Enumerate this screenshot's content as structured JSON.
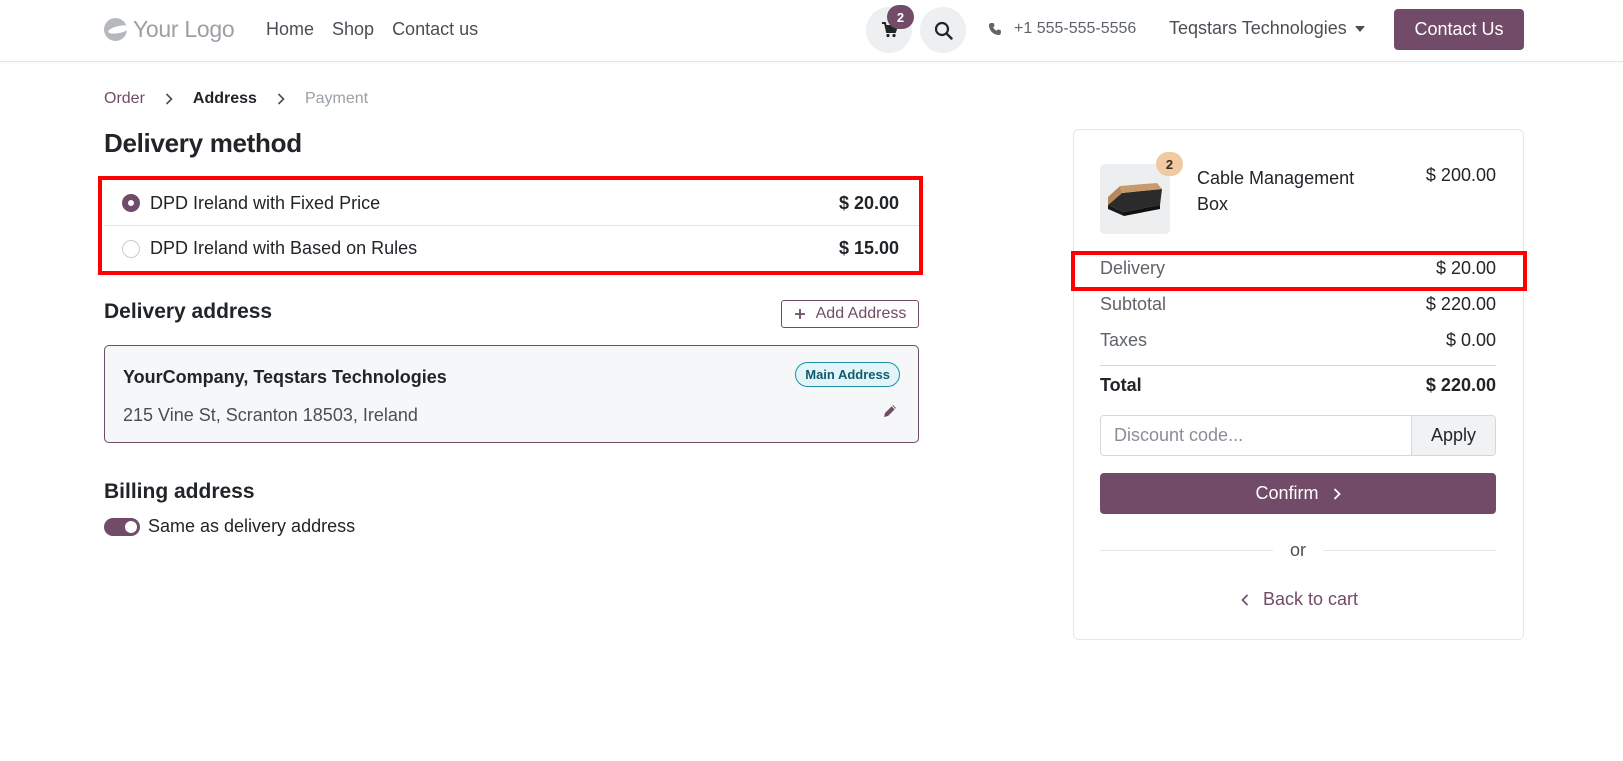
{
  "header": {
    "logo_text": "Your Logo",
    "nav": [
      "Home",
      "Shop",
      "Contact us"
    ],
    "cart_count": "2",
    "phone": "+1 555-555-5556",
    "company": "Teqstars Technologies",
    "contact_button": "Contact Us",
    "icons": {
      "cart": "shopping-cart-icon",
      "search": "search-icon",
      "phone": "phone-icon"
    }
  },
  "breadcrumb": {
    "steps": [
      "Order",
      "Address",
      "Payment"
    ],
    "active": "Address"
  },
  "delivery_method": {
    "title": "Delivery method",
    "options": [
      {
        "name": "DPD Ireland with Fixed Price",
        "price": "$ 20.00",
        "selected": true
      },
      {
        "name": "DPD Ireland with Based on Rules",
        "price": "$ 15.00",
        "selected": false
      }
    ]
  },
  "delivery_address": {
    "title": "Delivery address",
    "add_button": "Add Address",
    "card": {
      "name": "YourCompany, Teqstars Technologies",
      "badge": "Main Address",
      "address": "215 Vine St, Scranton 18503, Ireland"
    }
  },
  "billing_address": {
    "title": "Billing address",
    "toggle_label": "Same as delivery address",
    "toggle_on": true
  },
  "summary": {
    "product": {
      "name": "Cable Management Box",
      "quantity": "2",
      "price": "$ 200.00"
    },
    "delivery": {
      "label": "Delivery",
      "value": "$ 20.00"
    },
    "subtotal": {
      "label": "Subtotal",
      "value": "$ 220.00"
    },
    "taxes": {
      "label": "Taxes",
      "value": "$ 0.00"
    },
    "total": {
      "label": "Total",
      "value": "$ 220.00"
    },
    "discount_placeholder": "Discount code...",
    "apply_button": "Apply",
    "confirm_button": "Confirm",
    "or_text": "or",
    "back_link": "Back to cart"
  },
  "colors": {
    "brand": "#714b67",
    "highlight": "#ff0000",
    "badge_border": "#1f8fa6"
  }
}
